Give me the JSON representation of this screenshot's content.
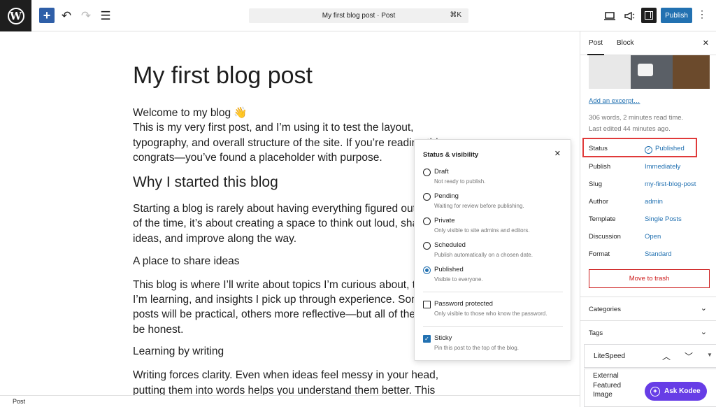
{
  "toolbar": {
    "add_icon": "plus-icon",
    "undo_icon": "undo-icon",
    "redo_icon": "redo-icon",
    "outline_icon": "list-view-icon",
    "command_title": "My first blog post · Post",
    "command_shortcut": "⌘K",
    "view_icon": "desktop-icon",
    "publish_label": "Publish"
  },
  "post": {
    "title": "My first blog post",
    "intro_line1": "Welcome to my blog 👋",
    "intro_line2": "This is my very first post, and I’m using it to test the layout,",
    "intro_line3": "typography, and overall structure of the site. If you’re reading this,",
    "intro_line4": "congrats—you’ve found a placeholder with purpose.",
    "h_why": "Why I started this blog",
    "why_line1": "Starting a blog is rarely about having everything figured out. Most",
    "why_line2": "of the time, it’s about creating a space to think out loud, share",
    "why_line3": "ideas, and improve along the way.",
    "h_place": "A place to share ideas",
    "place_line1": "This blog is where I’ll write about topics I’m curious about, things",
    "place_line2": "I’m learning, and insights I pick up through experience. Some",
    "place_line3": "posts will be practical, others more reflective—but all of them will",
    "place_line4": "be honest.",
    "h_learn": "Learning by writing",
    "learn_line1": "Writing forces clarity. Even when ideas feel messy in your head,",
    "learn_line2": "putting them into words helps you understand them better. This"
  },
  "popover": {
    "title": "Status & visibility",
    "options": [
      {
        "label": "Draft",
        "desc": "Not ready to publish."
      },
      {
        "label": "Pending",
        "desc": "Waiting for review before publishing."
      },
      {
        "label": "Private",
        "desc": "Only visible to site admins and editors."
      },
      {
        "label": "Scheduled",
        "desc": "Publish automatically on a chosen date."
      },
      {
        "label": "Published",
        "desc": "Visible to everyone."
      }
    ],
    "selected": "Published",
    "password_label": "Password protected",
    "password_desc": "Only visible to those who know the password.",
    "sticky_label": "Sticky",
    "sticky_desc": "Pin this post to the top of the blog."
  },
  "sidebar": {
    "tab_post": "Post",
    "tab_block": "Block",
    "excerpt_link": "Add an excerpt…",
    "word_count": "306 words, 2 minutes read time.",
    "last_edited": "Last edited 44 minutes ago.",
    "rows": [
      {
        "label": "Status",
        "value": "Published"
      },
      {
        "label": "Publish",
        "value": "Immediately"
      },
      {
        "label": "Slug",
        "value": "my-first-blog-post"
      },
      {
        "label": "Author",
        "value": "admin"
      },
      {
        "label": "Template",
        "value": "Single Posts"
      },
      {
        "label": "Discussion",
        "value": "Open"
      },
      {
        "label": "Format",
        "value": "Standard"
      }
    ],
    "trash_label": "Move to trash",
    "categories": "Categories",
    "tags": "Tags",
    "litespeed": "LiteSpeed",
    "efi_line1": "External",
    "efi_line2": "Featured",
    "efi_line3": "Image",
    "kodee": "Ask Kodee"
  },
  "footer": {
    "breadcrumb": "Post"
  },
  "colors": {
    "accent": "#2271b1",
    "highlight": "#e03a3a",
    "danger": "#cc1818",
    "kodee": "#673de6"
  }
}
